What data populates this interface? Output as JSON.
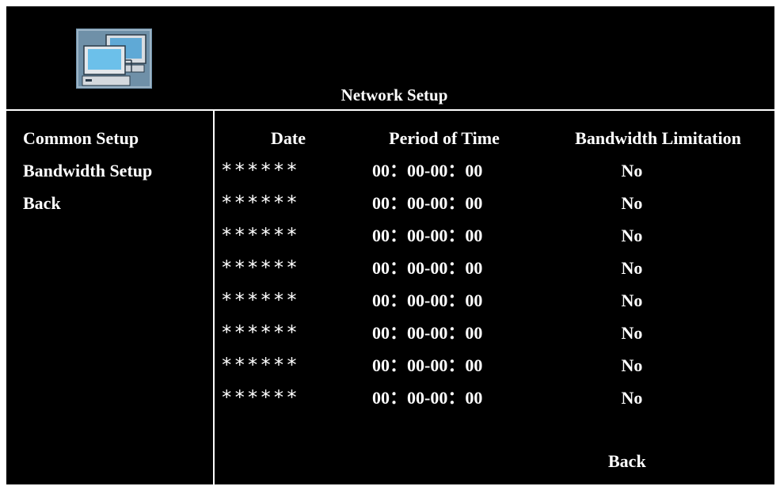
{
  "header": {
    "title": "Network Setup",
    "icon": "network-computers-icon"
  },
  "menu": {
    "items": [
      {
        "label": "Common Setup"
      },
      {
        "label": "Bandwidth Setup"
      },
      {
        "label": "Back"
      }
    ]
  },
  "table": {
    "columns": [
      "Date",
      "Period of Time",
      "Bandwidth Limitation"
    ],
    "rows": [
      {
        "date": "******",
        "period": "00：00-00：00",
        "limit": "No"
      },
      {
        "date": "******",
        "period": "00：00-00：00",
        "limit": "No"
      },
      {
        "date": "******",
        "period": "00：00-00：00",
        "limit": "No"
      },
      {
        "date": "******",
        "period": "00：00-00：00",
        "limit": "No"
      },
      {
        "date": "******",
        "period": "00：00-00：00",
        "limit": "No"
      },
      {
        "date": "******",
        "period": "00：00-00：00",
        "limit": "No"
      },
      {
        "date": "******",
        "period": "00：00-00：00",
        "limit": "No"
      },
      {
        "date": "******",
        "period": "00：00-00：00",
        "limit": "No"
      }
    ]
  },
  "footer": {
    "back_label": "Back"
  },
  "colors": {
    "background": "#000000",
    "text": "#ffffff",
    "icon_bg": "#6f90a8"
  }
}
